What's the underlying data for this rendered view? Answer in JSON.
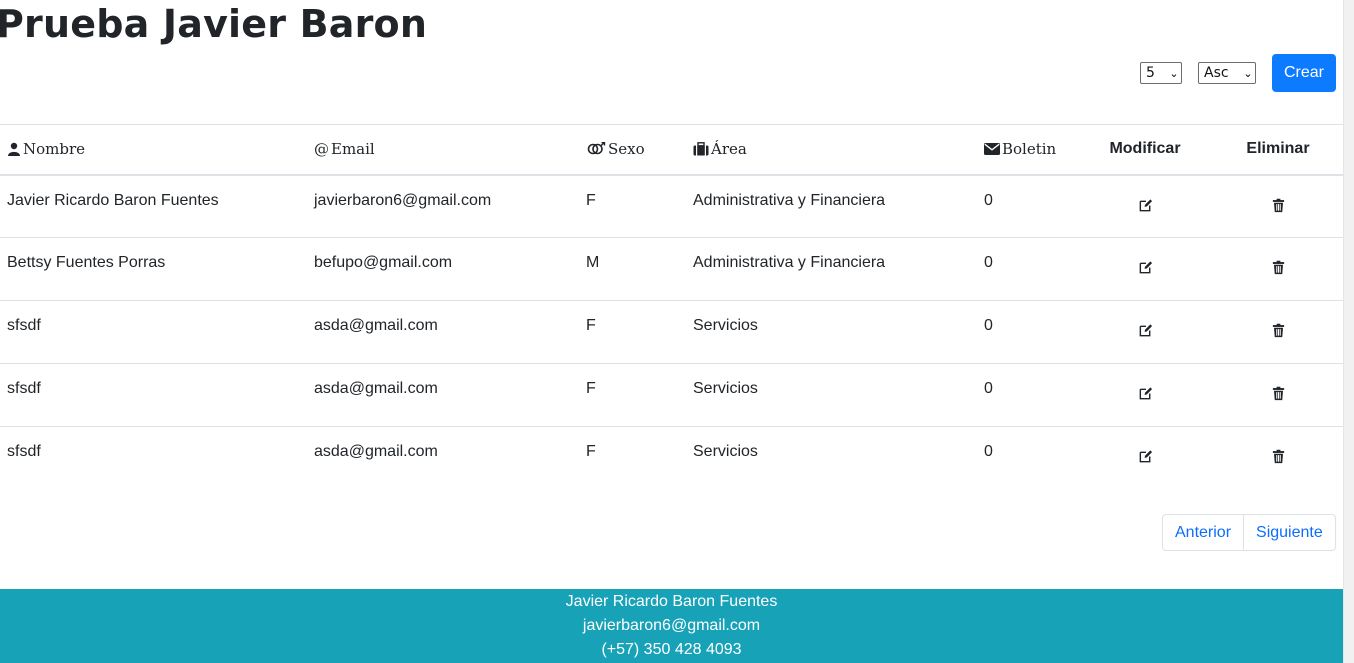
{
  "page": {
    "title": "Prueba Javier Baron"
  },
  "controls": {
    "page_size": {
      "selected": "5",
      "options": [
        "5"
      ]
    },
    "order": {
      "selected": "Asc",
      "options": [
        "Asc"
      ]
    },
    "create_label": "Crear"
  },
  "table": {
    "headers": {
      "nombre": {
        "label": "Nombre",
        "icon": "user-icon"
      },
      "email": {
        "label": "Email",
        "icon": "at-icon"
      },
      "sexo": {
        "label": "Sexo",
        "icon": "gender-icon"
      },
      "area": {
        "label": "Área",
        "icon": "briefcase-icon"
      },
      "boletin": {
        "label": "Boletin",
        "icon": "envelope-icon"
      },
      "modificar": "Modificar",
      "eliminar": "Eliminar"
    },
    "rows": [
      {
        "nombre": "Javier Ricardo Baron Fuentes",
        "email": "javierbaron6@gmail.com",
        "sexo": "F",
        "area": "Administrativa y Financiera",
        "boletin": "0"
      },
      {
        "nombre": "Bettsy Fuentes Porras",
        "email": "befupo@gmail.com",
        "sexo": "M",
        "area": "Administrativa y Financiera",
        "boletin": "0"
      },
      {
        "nombre": "sfsdf",
        "email": "asda@gmail.com",
        "sexo": "F",
        "area": "Servicios",
        "boletin": "0"
      },
      {
        "nombre": "sfsdf",
        "email": "asda@gmail.com",
        "sexo": "F",
        "area": "Servicios",
        "boletin": "0"
      },
      {
        "nombre": "sfsdf",
        "email": "asda@gmail.com",
        "sexo": "F",
        "area": "Servicios",
        "boletin": "0"
      }
    ],
    "actions": {
      "edit_icon": "edit-icon",
      "delete_icon": "trash-icon"
    }
  },
  "pagination": {
    "prev_label": "Anterior",
    "next_label": "Siguiente"
  },
  "footer": {
    "name": "Javier Ricardo Baron Fuentes",
    "email": "javierbaron6@gmail.com",
    "phone": "(+57) 350 428 4093"
  },
  "colors": {
    "primary": "#0d7bff",
    "footer_bg": "#17a2b8",
    "link": "#0d6efd",
    "border": "#dee2e6"
  }
}
